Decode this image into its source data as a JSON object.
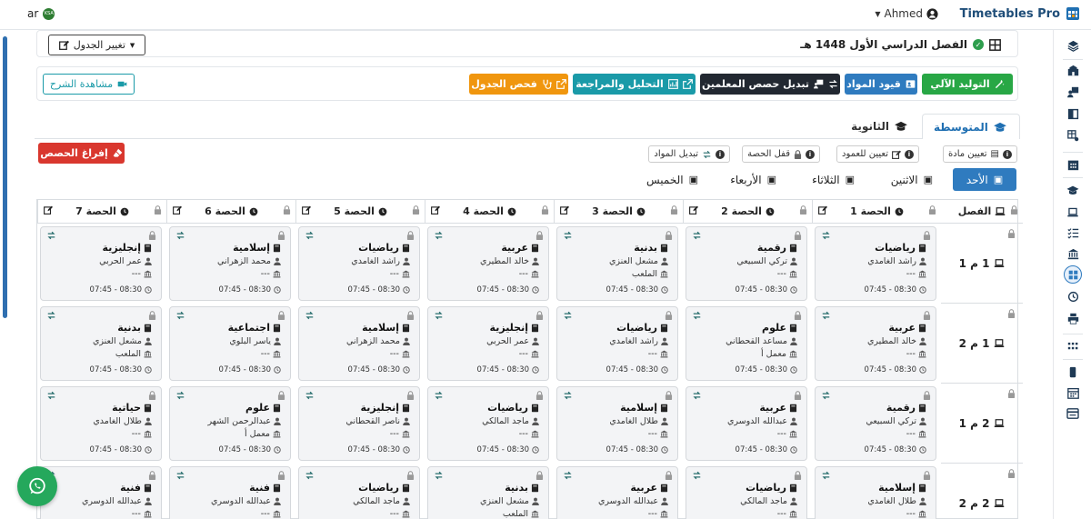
{
  "topbar": {
    "brand": "Timetables Pro",
    "user": "Ahmed",
    "lang": "ar",
    "flag_text": "KSA"
  },
  "header": {
    "semester": "الفصل الدراسي الأول 1448 هـ",
    "change_schedule": "تغيير الجدول"
  },
  "toolbar": {
    "auto_generate": "التوليد الآلي",
    "subject_constraints": "قيود المواد",
    "swap_teachers": "تبديل حصص المعلمين",
    "analysis": "التحليل والمراجعة",
    "check_schedule": "فحص الجدول",
    "watch_tutorial": "مشاهدة الشرح"
  },
  "tabs": {
    "middle": "المتوسطة",
    "secondary": "الثانوية"
  },
  "options": {
    "assign_subject": "تعيين مادة",
    "assign_column": "تعيين للعمود",
    "lock_lesson": "قفل الحصة",
    "swap_subjects": "تبديل المواد",
    "clear_lessons": "إفراغ الحصص"
  },
  "days": [
    "الأحد",
    "الاثنين",
    "الثلاثاء",
    "الأربعاء",
    "الخميس"
  ],
  "grid": {
    "class_header": "الفصل",
    "periods": [
      "الحصة 1",
      "الحصة 2",
      "الحصة 3",
      "الحصة 4",
      "الحصة 5",
      "الحصة 6",
      "الحصة 7"
    ],
    "time": "07:45 - 08:30",
    "rows": [
      {
        "label": "1 م 1",
        "cells": [
          {
            "subject": "رياضيات",
            "teacher": "راشد الغامدي",
            "room": "---"
          },
          {
            "subject": "رقمية",
            "teacher": "تركي السبيعي",
            "room": "---"
          },
          {
            "subject": "بدنية",
            "teacher": "مشعل العنزي",
            "room": "الملعب"
          },
          {
            "subject": "عربية",
            "teacher": "خالد المطيري",
            "room": "---"
          },
          {
            "subject": "رياضيات",
            "teacher": "راشد الغامدي",
            "room": "---"
          },
          {
            "subject": "إسلامية",
            "teacher": "محمد الزهراني",
            "room": "---"
          },
          {
            "subject": "إنجليزية",
            "teacher": "عمر الحربي",
            "room": "---"
          }
        ]
      },
      {
        "label": "1 م 2",
        "cells": [
          {
            "subject": "عربية",
            "teacher": "خالد المطيري",
            "room": "---"
          },
          {
            "subject": "علوم",
            "teacher": "مساعد القحطاني",
            "room": "معمل أ"
          },
          {
            "subject": "رياضيات",
            "teacher": "راشد الغامدي",
            "room": "---"
          },
          {
            "subject": "إنجليزية",
            "teacher": "عمر الحربي",
            "room": "---"
          },
          {
            "subject": "إسلامية",
            "teacher": "محمد الزهراني",
            "room": "---"
          },
          {
            "subject": "اجتماعية",
            "teacher": "ياسر البلوي",
            "room": "---"
          },
          {
            "subject": "بدنية",
            "teacher": "مشعل العنزي",
            "room": "الملعب"
          }
        ]
      },
      {
        "label": "2 م 1",
        "cells": [
          {
            "subject": "رقمية",
            "teacher": "تركي السبيعي",
            "room": "---"
          },
          {
            "subject": "عربية",
            "teacher": "عبدالله الدوسري",
            "room": "---"
          },
          {
            "subject": "إسلامية",
            "teacher": "طلال الغامدي",
            "room": "---"
          },
          {
            "subject": "رياضيات",
            "teacher": "ماجد المالكي",
            "room": "---"
          },
          {
            "subject": "إنجليزية",
            "teacher": "ناصر القحطاني",
            "room": "---"
          },
          {
            "subject": "علوم",
            "teacher": "عبدالرحمن الشهر",
            "room": "معمل أ"
          },
          {
            "subject": "حياتية",
            "teacher": "طلال الغامدي",
            "room": "---"
          }
        ]
      },
      {
        "label": "2 م 2",
        "cells": [
          {
            "subject": "إسلامية",
            "teacher": "طلال الغامدي",
            "room": "---"
          },
          {
            "subject": "رياضيات",
            "teacher": "ماجد المالكي",
            "room": "---"
          },
          {
            "subject": "عربية",
            "teacher": "عبدالله الدوسري",
            "room": "---"
          },
          {
            "subject": "بدنية",
            "teacher": "مشعل العنزي",
            "room": "الملعب"
          },
          {
            "subject": "رياضيات",
            "teacher": "ماجد المالكي",
            "room": "---"
          },
          {
            "subject": "فنية",
            "teacher": "عبدالله الدوسري",
            "room": "---"
          },
          {
            "subject": "فنية",
            "teacher": "عبدالله الدوسري",
            "room": "---"
          }
        ]
      }
    ]
  },
  "colors": {
    "green": "#28a745",
    "blue": "#2f7bbf",
    "dark": "#222831",
    "teal": "#1a9aa8",
    "orange": "#f0960e",
    "red": "#d9372e",
    "brand": "#1f4e79"
  }
}
